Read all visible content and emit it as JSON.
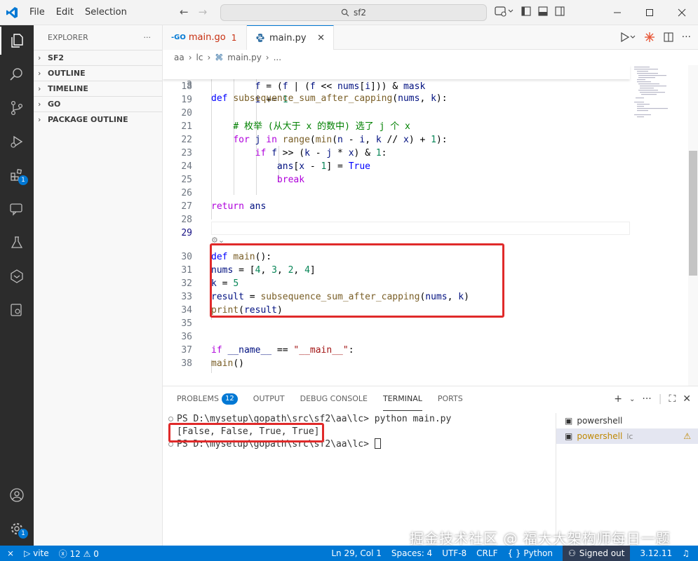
{
  "titlebar": {
    "menu": [
      "File",
      "Edit",
      "Selection"
    ],
    "search": "sf2"
  },
  "activity_bar": {
    "extensions_badge": "1",
    "settings_badge": "1"
  },
  "sidebar": {
    "title": "EXPLORER",
    "more": "···",
    "sections": [
      "SF2",
      "OUTLINE",
      "TIMELINE",
      "GO",
      "PACKAGE OUTLINE"
    ]
  },
  "tabs": [
    {
      "name": "main.go",
      "errors": "1",
      "active": false
    },
    {
      "name": "main.py",
      "active": true
    }
  ],
  "breadcrumb": {
    "parts": [
      "aa",
      "lc",
      "main.py",
      "..."
    ]
  },
  "editor": {
    "sticky": {
      "num": "3",
      "text": "def subsequence_sum_after_capping(nums, k):"
    },
    "lines": [
      {
        "num": "18",
        "text": "            f = (f | (f << nums[i])) & mask"
      },
      {
        "num": "19",
        "text": "            i += 1"
      },
      {
        "num": "20",
        "text": ""
      },
      {
        "num": "21",
        "text": "        # 枚举 (从大于 x 的数中) 选了 j 个 x"
      },
      {
        "num": "22",
        "text": "        for j in range(min(n - i, k // x) + 1):"
      },
      {
        "num": "23",
        "text": "            if f >> (k - j * x) & 1:"
      },
      {
        "num": "24",
        "text": "                ans[x - 1] = True"
      },
      {
        "num": "25",
        "text": "                break"
      },
      {
        "num": "26",
        "text": ""
      },
      {
        "num": "27",
        "text": "    return ans"
      },
      {
        "num": "28",
        "text": ""
      },
      {
        "num": "29",
        "text": ""
      },
      {
        "num": "30",
        "text": "def main():"
      },
      {
        "num": "31",
        "text": "    nums = [4, 3, 2, 4]"
      },
      {
        "num": "32",
        "text": "    k = 5"
      },
      {
        "num": "33",
        "text": "    result = subsequence_sum_after_capping(nums, k)"
      },
      {
        "num": "34",
        "text": "    print(result)"
      },
      {
        "num": "35",
        "text": ""
      },
      {
        "num": "36",
        "text": ""
      },
      {
        "num": "37",
        "text": "if __name__ == \"__main__\":"
      },
      {
        "num": "38",
        "text": "    main()"
      }
    ]
  },
  "panel": {
    "tabs": [
      "PROBLEMS",
      "OUTPUT",
      "DEBUG CONSOLE",
      "TERMINAL",
      "PORTS"
    ],
    "problems_count": "12",
    "terminal_lines": [
      "PS D:\\mysetup\\gopath\\src\\sf2\\aa\\lc> python main.py",
      "[False, False, True, True]",
      "PS D:\\mysetup\\gopath\\src\\sf2\\aa\\lc> "
    ],
    "terminals": [
      {
        "name": "powershell",
        "cwd": ""
      },
      {
        "name": "powershell",
        "cwd": "lc"
      }
    ]
  },
  "statusbar": {
    "left": [
      "vite",
      "12",
      "0"
    ],
    "position": "Ln 29, Col 1",
    "spaces": "Spaces: 4",
    "encoding": "UTF-8",
    "eol": "CRLF",
    "language": "Python",
    "account": "Signed out",
    "version": "3.12.11"
  },
  "watermark": "掘金技术社区 @ 福大大架构师每日一题",
  "colors": {
    "accent": "#0078d4",
    "highlight": "#e02a2a",
    "activity_bg": "#2c2c2c"
  }
}
